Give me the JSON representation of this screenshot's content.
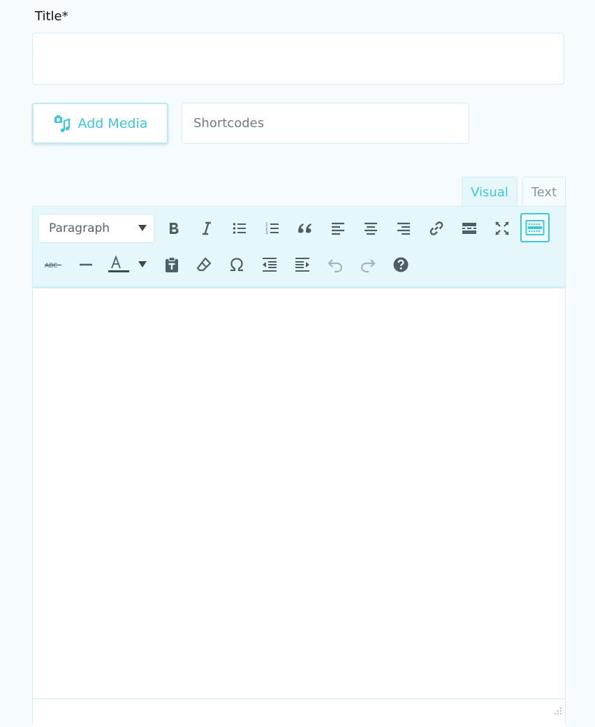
{
  "form": {
    "title_label": "Title*",
    "title_value": "",
    "add_media_label": "Add Media",
    "shortcodes_label": "Shortcodes"
  },
  "editor": {
    "tabs": [
      {
        "label": "Visual",
        "active": true
      },
      {
        "label": "Text",
        "active": false
      }
    ],
    "format_select": {
      "selected": "Paragraph"
    },
    "toolbar_row1": [
      {
        "name": "bold",
        "icon": "bold-icon"
      },
      {
        "name": "italic",
        "icon": "italic-icon"
      },
      {
        "name": "bullet-list",
        "icon": "bullet-list-icon"
      },
      {
        "name": "numbered-list",
        "icon": "numbered-list-icon"
      },
      {
        "name": "blockquote",
        "icon": "blockquote-icon"
      },
      {
        "name": "align-left",
        "icon": "align-left-icon"
      },
      {
        "name": "align-center",
        "icon": "align-center-icon"
      },
      {
        "name": "align-right",
        "icon": "align-right-icon"
      },
      {
        "name": "insert-link",
        "icon": "link-icon"
      },
      {
        "name": "read-more",
        "icon": "read-more-icon"
      },
      {
        "name": "fullscreen",
        "icon": "fullscreen-icon"
      },
      {
        "name": "toolbar-toggle",
        "icon": "kitchen-sink-icon",
        "active": true
      }
    ],
    "toolbar_row2": [
      {
        "name": "strikethrough",
        "icon": "strikethrough-icon"
      },
      {
        "name": "horizontal-line",
        "icon": "horizontal-line-icon"
      },
      {
        "name": "text-color",
        "icon": "text-color-icon"
      },
      {
        "name": "paste-as-text",
        "icon": "paste-text-icon"
      },
      {
        "name": "clear-formatting",
        "icon": "eraser-icon"
      },
      {
        "name": "special-character",
        "icon": "omega-icon"
      },
      {
        "name": "outdent",
        "icon": "outdent-icon"
      },
      {
        "name": "indent",
        "icon": "indent-icon"
      },
      {
        "name": "undo",
        "icon": "undo-icon"
      },
      {
        "name": "redo",
        "icon": "redo-icon"
      },
      {
        "name": "help",
        "icon": "help-icon"
      }
    ],
    "colors": {
      "accent": "#3cc7d8",
      "icon": "#4e5d66",
      "icon_disabled": "#a7b3b9",
      "toolbar_bg": "#e6f7fb",
      "border": "#cdeef5"
    }
  }
}
